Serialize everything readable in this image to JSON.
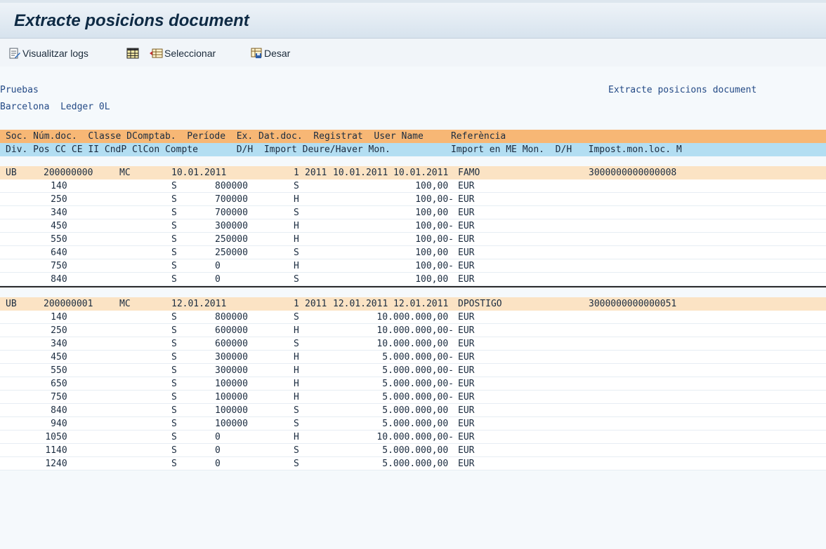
{
  "window": {
    "title": "Extracte posicions document"
  },
  "toolbar": {
    "view_logs": "Visualitzar logs",
    "select": "Seleccionar",
    "save": "Desar"
  },
  "header": {
    "line1_left": "Pruebas",
    "line1_right": "Extracte posicions document",
    "line2_left": "Barcelona  Ledger 0L"
  },
  "columns": {
    "header_row1": "Soc. Núm.doc.  Classe DComptab.  Període  Ex. Dat.doc.  Registrat  User Name     Referència",
    "header_row2": "Div. Pos CC CE II CndP ClCon Compte       D/H  Import Deure/Haver Mon.           Import en ME Mon.  D/H   Impost.mon.loc. M"
  },
  "documents": [
    {
      "header": {
        "soc": "UB",
        "doc_no": "200000000",
        "doc_type": "MC",
        "posting_date": "10.01.2011",
        "period": "1",
        "fiscal_year": "2011",
        "doc_date": "10.01.2011",
        "entry_date": "10.01.2011",
        "user": "FAMO",
        "reference": "3000000000000008"
      },
      "items": [
        {
          "pos": "1",
          "key": "40",
          "cl": "S",
          "account": "800000",
          "dh": "S",
          "amount": "100,00 ",
          "cur": "EUR"
        },
        {
          "pos": "2",
          "key": "50",
          "cl": "S",
          "account": "700000",
          "dh": "H",
          "amount": "100,00-",
          "cur": "EUR"
        },
        {
          "pos": "3",
          "key": "40",
          "cl": "S",
          "account": "700000",
          "dh": "S",
          "amount": "100,00 ",
          "cur": "EUR"
        },
        {
          "pos": "4",
          "key": "50",
          "cl": "S",
          "account": "300000",
          "dh": "H",
          "amount": "100,00-",
          "cur": "EUR"
        },
        {
          "pos": "5",
          "key": "50",
          "cl": "S",
          "account": "250000",
          "dh": "H",
          "amount": "100,00-",
          "cur": "EUR"
        },
        {
          "pos": "6",
          "key": "40",
          "cl": "S",
          "account": "250000",
          "dh": "S",
          "amount": "100,00 ",
          "cur": "EUR"
        },
        {
          "pos": "7",
          "key": "50",
          "cl": "S",
          "account": "0",
          "dh": "H",
          "amount": "100,00-",
          "cur": "EUR"
        },
        {
          "pos": "8",
          "key": "40",
          "cl": "S",
          "account": "0",
          "dh": "S",
          "amount": "100,00 ",
          "cur": "EUR"
        }
      ]
    },
    {
      "header": {
        "soc": "UB",
        "doc_no": "200000001",
        "doc_type": "MC",
        "posting_date": "12.01.2011",
        "period": "1",
        "fiscal_year": "2011",
        "doc_date": "12.01.2011",
        "entry_date": "12.01.2011",
        "user": "DPOSTIGO",
        "reference": "3000000000000051"
      },
      "items": [
        {
          "pos": "1",
          "key": "40",
          "cl": "S",
          "account": "800000",
          "dh": "S",
          "amount": "10.000.000,00 ",
          "cur": "EUR"
        },
        {
          "pos": "2",
          "key": "50",
          "cl": "S",
          "account": "600000",
          "dh": "H",
          "amount": "10.000.000,00-",
          "cur": "EUR"
        },
        {
          "pos": "3",
          "key": "40",
          "cl": "S",
          "account": "600000",
          "dh": "S",
          "amount": "10.000.000,00 ",
          "cur": "EUR"
        },
        {
          "pos": "4",
          "key": "50",
          "cl": "S",
          "account": "300000",
          "dh": "H",
          "amount": "5.000.000,00-",
          "cur": "EUR"
        },
        {
          "pos": "5",
          "key": "50",
          "cl": "S",
          "account": "300000",
          "dh": "H",
          "amount": "5.000.000,00-",
          "cur": "EUR"
        },
        {
          "pos": "6",
          "key": "50",
          "cl": "S",
          "account": "100000",
          "dh": "H",
          "amount": "5.000.000,00-",
          "cur": "EUR"
        },
        {
          "pos": "7",
          "key": "50",
          "cl": "S",
          "account": "100000",
          "dh": "H",
          "amount": "5.000.000,00-",
          "cur": "EUR"
        },
        {
          "pos": "8",
          "key": "40",
          "cl": "S",
          "account": "100000",
          "dh": "S",
          "amount": "5.000.000,00 ",
          "cur": "EUR"
        },
        {
          "pos": "9",
          "key": "40",
          "cl": "S",
          "account": "100000",
          "dh": "S",
          "amount": "5.000.000,00 ",
          "cur": "EUR"
        },
        {
          "pos": "10",
          "key": "50",
          "cl": "S",
          "account": "0",
          "dh": "H",
          "amount": "10.000.000,00-",
          "cur": "EUR"
        },
        {
          "pos": "11",
          "key": "40",
          "cl": "S",
          "account": "0",
          "dh": "S",
          "amount": "5.000.000,00 ",
          "cur": "EUR"
        },
        {
          "pos": "12",
          "key": "40",
          "cl": "S",
          "account": "0",
          "dh": "S",
          "amount": "5.000.000,00 ",
          "cur": "EUR"
        }
      ]
    }
  ],
  "colors": {
    "header_orange": "#f7b775",
    "header_blue": "#b3def2",
    "doc_row": "#fbe3c4",
    "text_blue": "#244a86"
  }
}
